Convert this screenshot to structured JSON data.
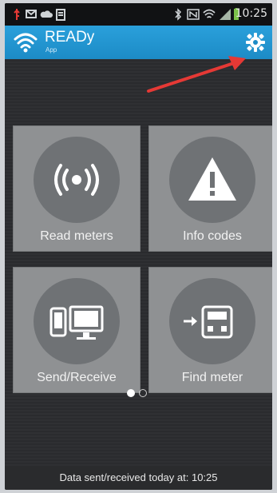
{
  "status_bar": {
    "time": "10:25",
    "left_icons": [
      "usb-icon",
      "message-icon",
      "cloud-icon",
      "clipboard-icon"
    ],
    "right_icons": [
      "bluetooth-icon",
      "nfc-icon",
      "wifi-icon",
      "signal-icon",
      "battery-icon"
    ]
  },
  "app_bar": {
    "title": "READy",
    "subtitle": "App",
    "settings_icon": "gear-icon",
    "accent_color": "#1c8bc6"
  },
  "tiles": [
    {
      "label": "Read meters",
      "icon": "radio-waves-icon"
    },
    {
      "label": "Info codes",
      "icon": "warning-icon"
    },
    {
      "label": "Send/Receive",
      "icon": "phone-computer-icon"
    },
    {
      "label": "Find meter",
      "icon": "meter-arrow-icon"
    }
  ],
  "pager": {
    "pages": 2,
    "active": 1
  },
  "footer": {
    "text": "Data sent/received today at: 10:25"
  },
  "annotation": {
    "arrow_color": "#e53935",
    "target": "settings"
  }
}
